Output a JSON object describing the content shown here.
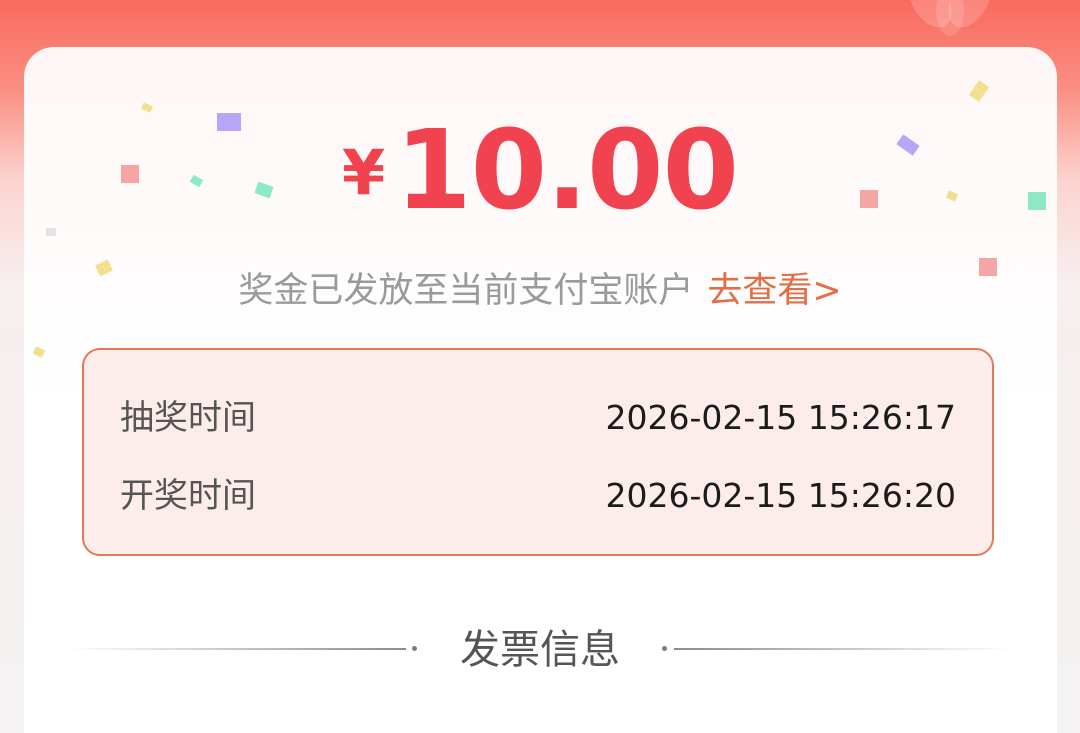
{
  "prize": {
    "currency": "¥",
    "amount": "10.00"
  },
  "notice": {
    "message": "奖金已发放至当前支付宝账户",
    "link_label": "去查看>"
  },
  "times": {
    "draw_label": "抽奖时间",
    "draw_value": "2026-02-15 15:26:17",
    "announce_label": "开奖时间",
    "announce_value": "2026-02-15 15:26:20"
  },
  "invoice": {
    "section_title": "发票信息"
  },
  "colors": {
    "amount": "#f1424f",
    "link": "#e06f45",
    "box_border": "#e27a58",
    "box_background": "#fdedea"
  }
}
